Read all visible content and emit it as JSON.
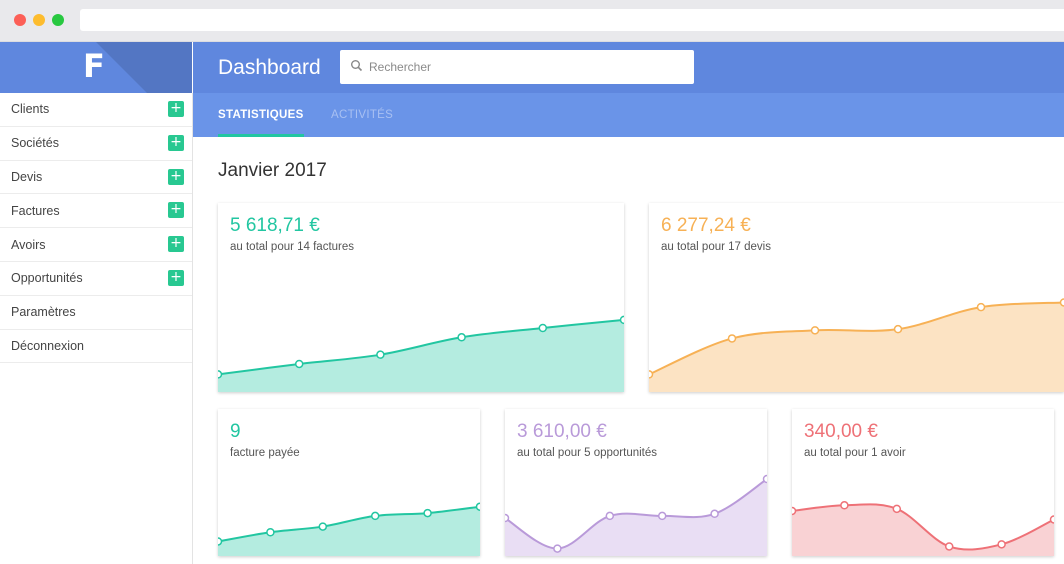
{
  "app": {
    "logo_letter": "F",
    "title": "Dashboard"
  },
  "search": {
    "placeholder": "Rechercher"
  },
  "sidebar": {
    "items": [
      {
        "label": "Clients",
        "has_add": true
      },
      {
        "label": "Sociétés",
        "has_add": true
      },
      {
        "label": "Devis",
        "has_add": true
      },
      {
        "label": "Factures",
        "has_add": true
      },
      {
        "label": "Avoirs",
        "has_add": true
      },
      {
        "label": "Opportunités",
        "has_add": true
      },
      {
        "label": "Paramètres",
        "has_add": false
      },
      {
        "label": "Déconnexion",
        "has_add": false
      }
    ]
  },
  "tabs": [
    {
      "label": "STATISTIQUES",
      "active": true
    },
    {
      "label": "ACTIVITÉS",
      "active": false
    }
  ],
  "main": {
    "period": "Janvier 2017"
  },
  "colors": {
    "header": "#5f87de",
    "tabs": "#6a94e8",
    "teal": "#22c6a1",
    "orange": "#f7b155",
    "purple": "#b99ad9",
    "red": "#ee7177"
  },
  "cards": [
    {
      "value": "5 618,71 €",
      "subtitle": "au total pour 14 factures",
      "color": "#22c6a1",
      "fill": "#b4ece0",
      "trend": [
        0.1,
        0.19,
        0.27,
        0.42,
        0.5,
        0.57
      ]
    },
    {
      "value": "6 277,24 €",
      "subtitle": "au total pour 17 devis",
      "color": "#f7b155",
      "fill": "#fce3c3",
      "trend": [
        0.1,
        0.41,
        0.48,
        0.49,
        0.68,
        0.72
      ]
    },
    {
      "value": "9",
      "subtitle": "facture payée",
      "color": "#22c6a1",
      "fill": "#b4ece0",
      "trend": [
        0.12,
        0.25,
        0.33,
        0.48,
        0.52,
        0.61
      ]
    },
    {
      "value": "3 610,00 €",
      "subtitle": "au total pour 5 opportunités",
      "color": "#b99ad9",
      "fill": "#e9def4",
      "trend": [
        0.45,
        0.02,
        0.48,
        0.48,
        0.51,
        1.0
      ]
    },
    {
      "value": "340,00 €",
      "subtitle": "au total pour 1 avoir",
      "color": "#ee7177",
      "fill": "#f9d2d4",
      "trend": [
        0.55,
        0.63,
        0.58,
        0.05,
        0.08,
        0.43
      ]
    }
  ]
}
